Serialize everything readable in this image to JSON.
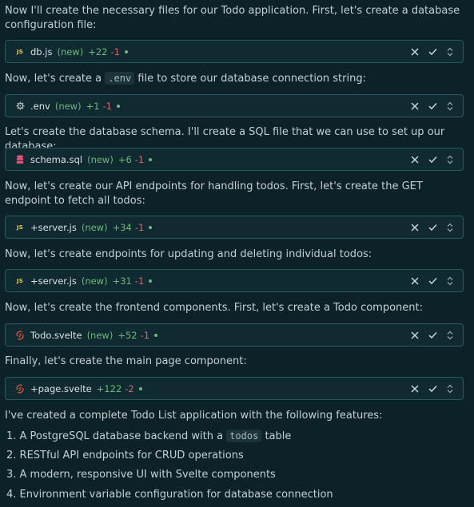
{
  "messages": [
    {
      "text": "Now I'll create the necessary files for our Todo application. First, let's create a database configuration file:"
    },
    {
      "pre": "Now, let's create a ",
      "code": ".env",
      "post": " file to store our database connection string:"
    },
    {
      "text": "Let's create the database schema. I'll create a SQL file that we can use to set up our database:"
    },
    {
      "text": "Now, let's create our API endpoints for handling todos. First, let's create the GET endpoint to fetch all todos:"
    },
    {
      "text": "Now, let's create endpoints for updating and deleting individual todos:"
    },
    {
      "text": "Now, let's create the frontend components. First, let's create a Todo component:"
    },
    {
      "text": "Finally, let's create the main page component:"
    },
    {
      "text": "I've created a complete Todo List application with the following features:"
    }
  ],
  "files": [
    {
      "icon": "js-icon",
      "icon_label": "JS",
      "name": "db.js",
      "status": "(new)",
      "added": "+22",
      "removed": "-1"
    },
    {
      "icon": "gear-icon",
      "name": ".env",
      "status": "(new)",
      "added": "+1",
      "removed": "-1"
    },
    {
      "icon": "database-icon",
      "name": "schema.sql",
      "status": "(new)",
      "added": "+6",
      "removed": "-1"
    },
    {
      "icon": "js-icon",
      "icon_label": "JS",
      "name": "+server.js",
      "status": "(new)",
      "added": "+34",
      "removed": "-1"
    },
    {
      "icon": "js-icon",
      "icon_label": "JS",
      "name": "+server.js",
      "status": "(new)",
      "added": "+31",
      "removed": "-1"
    },
    {
      "icon": "svelte-icon",
      "name": "Todo.svelte",
      "status": "(new)",
      "added": "+52",
      "removed": "-1"
    },
    {
      "icon": "svelte-icon",
      "name": "+page.svelte",
      "status": "",
      "added": "+122",
      "removed": "-2"
    }
  ],
  "features": [
    {
      "pre": "1. A PostgreSQL database backend with a ",
      "code": "todos",
      "post": " table"
    },
    {
      "text": "2. RESTful API endpoints for CRUD operations"
    },
    {
      "text": "3. A modern, responsive UI with Svelte components"
    },
    {
      "text": "4. Environment variable configuration for database connection"
    }
  ],
  "colors": {
    "background": "#0c2228",
    "card_border": "#2a5a60",
    "added": "#6fb77a",
    "removed": "#d56a6a",
    "js": "#e6cf4a",
    "svelte": "#e0573a",
    "database": "#e2567a"
  }
}
